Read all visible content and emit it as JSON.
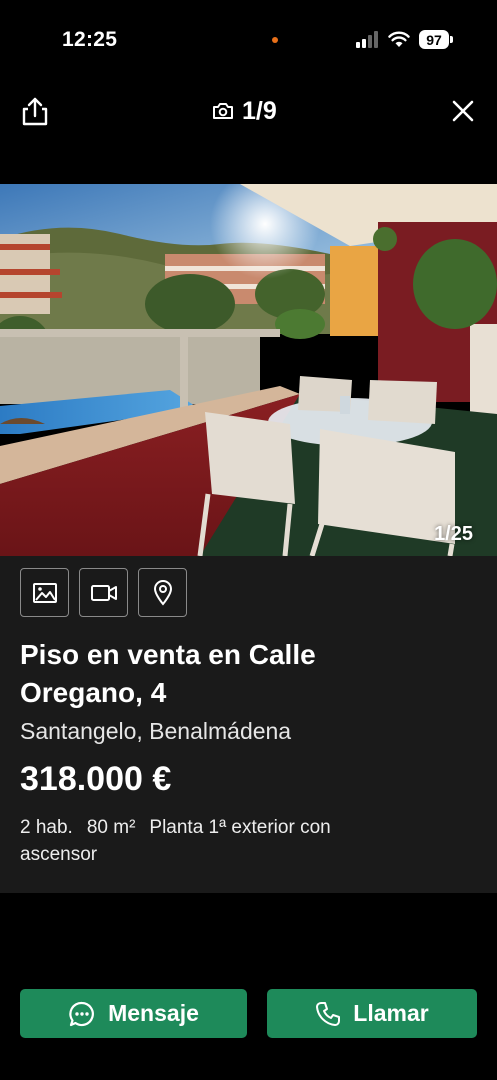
{
  "status_bar": {
    "time": "12:25",
    "battery": "97",
    "dot_color": "#e8701a"
  },
  "gallery": {
    "counter": "1/9",
    "photo_counter": "1/25",
    "icons": [
      "share-icon",
      "camera-icon",
      "close-icon"
    ]
  },
  "listing": {
    "title": "Piso en venta en Calle Oregano, 4",
    "location": "Santangelo, Benalmádena",
    "price": "318.000 €",
    "features": [
      "2 hab.",
      "80 m²",
      "Planta 1ª exterior con ascensor"
    ],
    "media_buttons": [
      "photo-icon",
      "video-icon",
      "map-pin-icon"
    ]
  },
  "actions": {
    "message_label": "Mensaje",
    "call_label": "Llamar",
    "accent_color": "#1e8a5a"
  }
}
